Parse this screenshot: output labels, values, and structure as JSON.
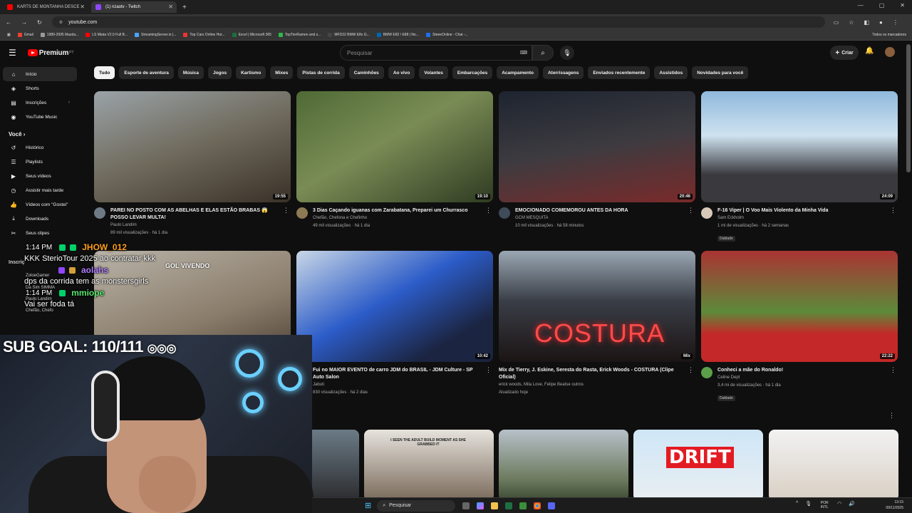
{
  "browser": {
    "tabs": [
      {
        "title": "KARTS DE MONTANHA DESCE",
        "color": "#ff0000",
        "active": false
      },
      {
        "title": "(1) nzaotv - Twitch",
        "color": "#9146ff",
        "active": true
      }
    ],
    "url": "youtube.com",
    "bookmarks": [
      "Gmail",
      "1989-2005 Mazda...",
      "LS Miata V2.0 Full B...",
      "StreamingServer.io |...",
      "Top Cars Online Hor...",
      "Excel | Microsoft 365",
      "TopTierRamen and s...",
      "MFD32 BMW E8x G...",
      "BMW E82 / E88 | No...",
      "SteeeOnline - Chat -..."
    ],
    "bookmarks_right": "Todos os marcadores"
  },
  "youtube": {
    "logo_text": "Premium",
    "logo_sup": "PT",
    "search_placeholder": "Pesquisar",
    "create_label": "Criar",
    "sidebar": [
      {
        "label": "Início",
        "icon": "home-icon",
        "glyph": "⌂",
        "active": true
      },
      {
        "label": "Shorts",
        "icon": "shorts-icon",
        "glyph": "◈"
      },
      {
        "label": "Inscrições",
        "icon": "subscriptions-icon",
        "glyph": "▤"
      },
      {
        "label": "YouTube Music",
        "icon": "music-icon",
        "glyph": "◉"
      }
    ],
    "you_heading": "Você",
    "you_items": [
      {
        "label": "Histórico",
        "icon": "history-icon",
        "glyph": "↺"
      },
      {
        "label": "Playlists",
        "icon": "playlists-icon",
        "glyph": "☰"
      },
      {
        "label": "Seus vídeos",
        "icon": "your-videos-icon",
        "glyph": "▶"
      },
      {
        "label": "Assistir mais tarde",
        "icon": "watch-later-icon",
        "glyph": "◷"
      },
      {
        "label": "Vídeos com \"Gostei\"",
        "icon": "liked-icon",
        "glyph": "👍"
      },
      {
        "label": "Downloads",
        "icon": "downloads-icon",
        "glyph": "⤓"
      },
      {
        "label": "Seus clipes",
        "icon": "clips-icon",
        "glyph": "✂"
      }
    ],
    "subscriptions_partial": [
      "Inscriç",
      "ZoloeGamer",
      "Da Sim SIMMA",
      "Paulo Landim",
      "Chefão, Chefo"
    ],
    "chips": [
      "Tudo",
      "Esporte de aventura",
      "Música",
      "Jogos",
      "Kartismo",
      "Mixes",
      "Pistas de corrida",
      "Caminhões",
      "Ao vivo",
      "Volantes",
      "Embarcações",
      "Acampamento",
      "Aterrissagens",
      "Enviados recentemente",
      "Assistidos",
      "Novidades para você"
    ],
    "videos": [
      {
        "title": "PAREI NO POSTO COM AS ABELHAS E ELAS ESTÃO BRABAS 😱 POSSO LEVAR MULTA!",
        "channel": "Paulo Landim",
        "stats": "89 mil visualizações · há 1 dia",
        "duration": "19:55",
        "badge": ""
      },
      {
        "title": "3 Dias Caçando iguanas com Zarabatana, Preparei um Churrasco",
        "channel": "Chefão, Chefona e Chefinho",
        "stats": "49 mil visualizações · há 1 dia",
        "duration": "19:10",
        "badge": ""
      },
      {
        "title": "EMOCIONADO COMEMOROU ANTES DA HORA",
        "channel": "GCM MESQUITA",
        "stats": "10 mil visualizações · há 58 minutos",
        "duration": "20:46",
        "badge": ""
      },
      {
        "title": "F-16 Viper | O Voo Mais Violento da Minha Vida",
        "channel": "Sam Eckholm",
        "stats": "1 mi de visualizações · há 2 semanas",
        "duration": "24:09",
        "badge": "Dublado"
      },
      {
        "title": "",
        "channel": "",
        "stats": "",
        "duration": "",
        "badge": ""
      },
      {
        "title": "Fui no MAIOR EVENTO de carro JDM do BRASIL - JDM Culture - SP Auto Salon",
        "channel": "Jabuti",
        "stats": "830 visualizações · há 2 dias",
        "duration": "10:42",
        "badge": ""
      },
      {
        "title": "Mix de Tierry, J. Eskine, Seresta do Rasta, Erick Woods - COSTURA (Clipe Oficial)",
        "channel": "erick woods, Mila Love, Felipe Beatse outros",
        "stats": "Atualizado hoje",
        "duration": "Mix",
        "badge": ""
      },
      {
        "title": "Conheci a mãe do Ronaldo!",
        "channel": "Celine Dept",
        "stats": "3,4 mi de visualizações · há 1 dia",
        "duration": "22:22",
        "badge": "Dublado"
      }
    ],
    "thumb_texts": {
      "v5": "GOL VIVENDO",
      "v7": "COSTURA",
      "short4": "DRIFT",
      "short2": "I SEEN THE ADULT BUILD MOMENT AS SHE GRABBED IT"
    }
  },
  "stream": {
    "chat": [
      {
        "time": "1:14 PM",
        "user": "JHOW_012",
        "user_color": "#ff9f1a",
        "text": ""
      },
      {
        "time": "",
        "user": "",
        "user_color": "#ffffff",
        "text": "KKK SterioTour 2025 ao contratar kkk"
      },
      {
        "time": "",
        "user": "aolahs",
        "user_color": "#b07dff",
        "text": ""
      },
      {
        "time": "",
        "user": "",
        "user_color": "#ffffff",
        "text": "dps da corrida tem as monstersgirls"
      },
      {
        "time": "1:14 PM",
        "user": "mmiope",
        "user_color": "#58e56b",
        "text": ""
      },
      {
        "time": "",
        "user": "",
        "user_color": "#ffffff",
        "text": "Vai ser foda tá"
      }
    ],
    "sub_goal": "SUB GOAL: 110/111"
  },
  "taskbar": {
    "search_label": "Pesquisar",
    "lang": "POR INTL",
    "time": "13:15",
    "date": "09/11/2025"
  }
}
